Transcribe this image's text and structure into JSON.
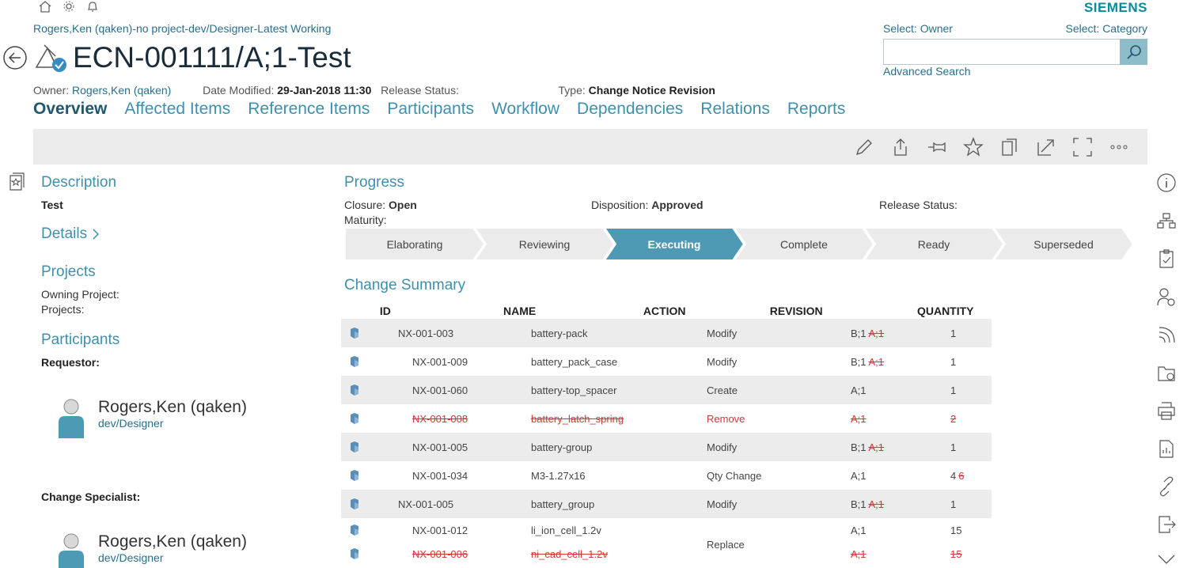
{
  "brand": "SIEMENS",
  "breadcrumb": "Rogers,Ken (qaken)-no project-dev/Designer-Latest Working",
  "title": "ECN-001111/A;1-Test",
  "meta": {
    "owner_label": "Owner:",
    "owner_value": "Rogers,Ken (qaken)",
    "date_label": "Date Modified:",
    "date_value": "29-Jan-2018 11:30",
    "release_label": "Release Status:",
    "type_label": "Type:",
    "type_value": "Change Notice Revision"
  },
  "tabs": [
    "Overview",
    "Affected Items",
    "Reference Items",
    "Participants",
    "Workflow",
    "Dependencies",
    "Relations",
    "Reports"
  ],
  "search": {
    "owner_label": "Select: Owner",
    "category_label": "Select: Category",
    "value": "",
    "advanced": "Advanced Search"
  },
  "left": {
    "description_h": "Description",
    "description_v": "Test",
    "details": "Details",
    "projects_h": "Projects",
    "owning_project": "Owning Project:",
    "projects": "Projects:",
    "participants_h": "Participants",
    "requestor_label": "Requestor:",
    "requestor_name": "Rogers,Ken (qaken)",
    "requestor_role": "dev/Designer",
    "specialist_label": "Change Specialist:",
    "specialist_name": "Rogers,Ken (qaken)",
    "specialist_role": "dev/Designer"
  },
  "progress": {
    "heading": "Progress",
    "closure_label": "Closure:",
    "closure_value": "Open",
    "disposition_label": "Disposition:",
    "disposition_value": "Approved",
    "release_label": "Release Status:",
    "maturity_label": "Maturity:",
    "steps": [
      "Elaborating",
      "Reviewing",
      "Executing",
      "Complete",
      "Ready",
      "Superseded"
    ],
    "active_step": "Executing"
  },
  "change_summary": {
    "heading": "Change Summary",
    "columns": [
      "ID",
      "NAME",
      "ACTION",
      "REVISION",
      "QUANTITY"
    ],
    "rows": [
      {
        "id": "NX-001-003",
        "name": "battery-pack",
        "action": "Modify",
        "rev": "B;1",
        "rev_old": "A;1",
        "qty": "1",
        "qty_old": ""
      },
      {
        "id": "NX-001-009",
        "name": "battery_pack_case",
        "action": "Modify",
        "rev": "B;1",
        "rev_old": "A;1",
        "qty": "1",
        "qty_old": ""
      },
      {
        "id": "NX-001-060",
        "name": "battery-top_spacer",
        "action": "Create",
        "rev": "A;1",
        "rev_old": "",
        "qty": "1",
        "qty_old": ""
      },
      {
        "id": "NX-001-008",
        "name": "battery_latch_spring",
        "action": "Remove",
        "rev": "A;1",
        "rev_old": "",
        "qty": "2",
        "qty_old": ""
      },
      {
        "id": "NX-001-005",
        "name": "battery-group",
        "action": "Modify",
        "rev": "B;1",
        "rev_old": "A;1",
        "qty": "1",
        "qty_old": ""
      },
      {
        "id": "NX-001-034",
        "name": "M3-1.27x16",
        "action": "Qty Change",
        "rev": "A;1",
        "rev_old": "",
        "qty": "4",
        "qty_old": "6"
      },
      {
        "id": "NX-001-005",
        "name": "battery_group",
        "action": "Modify",
        "rev": "B;1",
        "rev_old": "A;1",
        "qty": "1",
        "qty_old": ""
      },
      {
        "id": "NX-001-012",
        "name": "li_ion_cell_1.2v",
        "action": "Replace",
        "rev": "A;1",
        "rev_old": "",
        "qty": "15",
        "qty_old": ""
      },
      {
        "id": "NX-001-006",
        "name": "ni_cad_cell_1.2v",
        "action": "",
        "rev": "A;1",
        "rev_old": "",
        "qty": "15",
        "qty_old": ""
      }
    ]
  },
  "colors": {
    "accent": "#4e9ab5",
    "strike": "#d2373a",
    "brand": "#0a8a9b"
  }
}
